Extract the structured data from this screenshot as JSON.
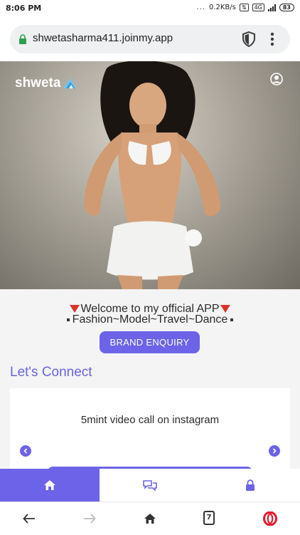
{
  "status_bar": {
    "time": "8:06 PM",
    "network_speed": "0.2KB/s",
    "network_type": "4G",
    "battery": "83"
  },
  "browser": {
    "url": "shwetasharma411.joinmy.app",
    "tab_count": "7",
    "icons": [
      "lock-icon",
      "shield-icon",
      "kebab-menu-icon",
      "back-arrow-icon",
      "forward-arrow-icon",
      "home-icon",
      "tabs-icon",
      "opera-icon"
    ]
  },
  "site": {
    "brand": "shweta",
    "welcome_text": "Welcome to my official APP",
    "tagline": "Fashion~Model~Travel~Dance",
    "enquiry_button": "BRAND ENQUIRY",
    "connect_title": "Let's Connect",
    "card_text": "5mint video call on instagram"
  },
  "app_nav": {
    "items": [
      "home-icon",
      "chat-icon",
      "lock-icon"
    ],
    "active": "home"
  },
  "colors": {
    "accent": "#6c63e8",
    "triangle": "#d9342b",
    "panel_bg": "#f4f4f5"
  }
}
